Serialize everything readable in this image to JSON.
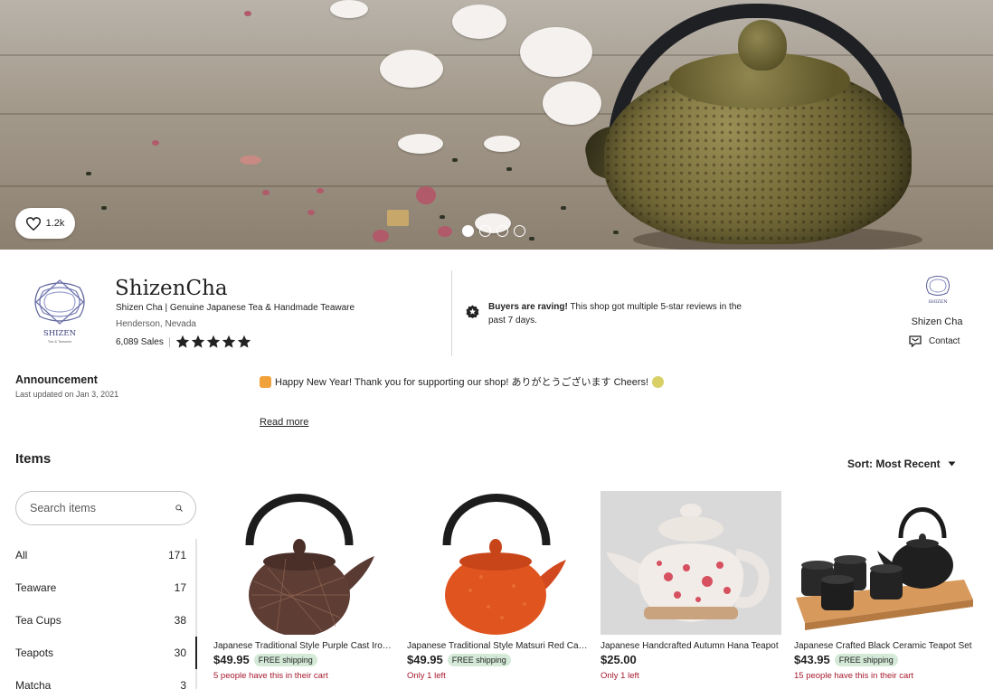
{
  "banner": {
    "favorites_count": "1.2k",
    "slides": 4,
    "active_slide": 1
  },
  "shop": {
    "name": "ShizenCha",
    "title": "Shizen Cha | Genuine Japanese Tea & Handmade Teaware",
    "location": "Henderson, Nevada",
    "sales": "6,089 Sales",
    "rating": 5,
    "logo_text": "SHIZEN",
    "logo_subtext": "Tea & Teaware",
    "rave_strong": "Buyers are raving!",
    "rave_rest": " This shop got multiple 5-star reviews in the past 7 days.",
    "owner_name": "Shizen Cha",
    "contact_label": "Contact"
  },
  "announcement": {
    "title": "Announcement",
    "updated": "Last updated on Jan 3, 2021",
    "text": "Happy New Year! Thank you for supporting our shop! ありがとうございます Cheers!",
    "read_more": "Read more"
  },
  "items": {
    "heading": "Items",
    "sort_label": "Sort: Most Recent",
    "search_placeholder": "Search items",
    "categories": [
      {
        "name": "All",
        "count": "171"
      },
      {
        "name": "Teaware",
        "count": "17"
      },
      {
        "name": "Tea Cups",
        "count": "38"
      },
      {
        "name": "Teapots",
        "count": "30"
      },
      {
        "name": "Matcha",
        "count": "3"
      }
    ],
    "selected_category": "Teapots",
    "products": [
      {
        "title": "Japanese Traditional Style Purple Cast Iron Teapot",
        "price": "$49.95",
        "shipping": "FREE shipping",
        "note": "5 people have this in their cart"
      },
      {
        "title": "Japanese Traditional Style Matsuri Red Cast Iron Teapot",
        "price": "$49.95",
        "shipping": "FREE shipping",
        "note": "Only 1 left"
      },
      {
        "title": "Japanese Handcrafted Autumn Hana Teapot",
        "price": "$25.00",
        "shipping": "",
        "note": "Only 1 left"
      },
      {
        "title": "Japanese Crafted Black Ceramic Teapot Set",
        "price": "$43.95",
        "shipping": "FREE shipping",
        "note": "15 people have this in their cart"
      }
    ]
  },
  "colors": {
    "accent_note": "#a61a2e",
    "shipping_badge": "#d4e9d7",
    "text": "#222222"
  }
}
